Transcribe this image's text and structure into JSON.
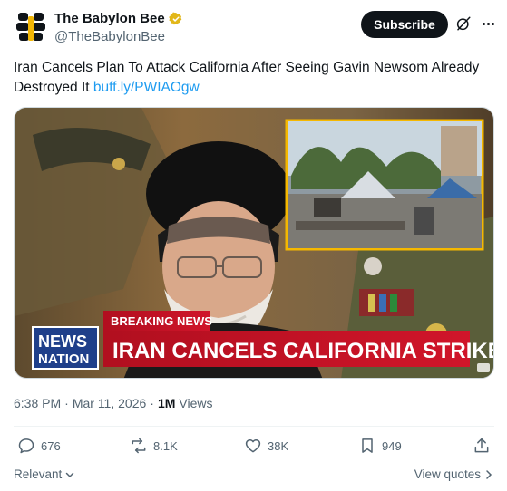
{
  "author": {
    "display_name": "The Babylon Bee",
    "handle": "@TheBabylonBee",
    "avatar_icon": "bee-logo-icon",
    "verified_color": "#e2b719"
  },
  "header": {
    "subscribe_label": "Subscribe"
  },
  "tweet": {
    "text": "Iran Cancels Plan To Attack California After Seeing Gavin Newsom Already Destroyed It ",
    "link": "buff.ly/PWIAOgw"
  },
  "media": {
    "breaking_label": "BREAKING NEWS",
    "headline": "IRAN CANCELS CALIFORNIA STRIKE",
    "network_top": "NEWS",
    "network_bottom": "NATION",
    "accent_color": "#c8102e",
    "inset_border_color": "#f5b800"
  },
  "meta": {
    "time": "6:38 PM",
    "separator": "·",
    "date": "Mar 11, 2026",
    "views_count": "1M",
    "views_label": "Views"
  },
  "actions": {
    "replies": "676",
    "reposts": "8.1K",
    "likes": "38K",
    "bookmarks": "949"
  },
  "footer": {
    "relevant_label": "Relevant",
    "view_quotes_label": "View quotes"
  }
}
